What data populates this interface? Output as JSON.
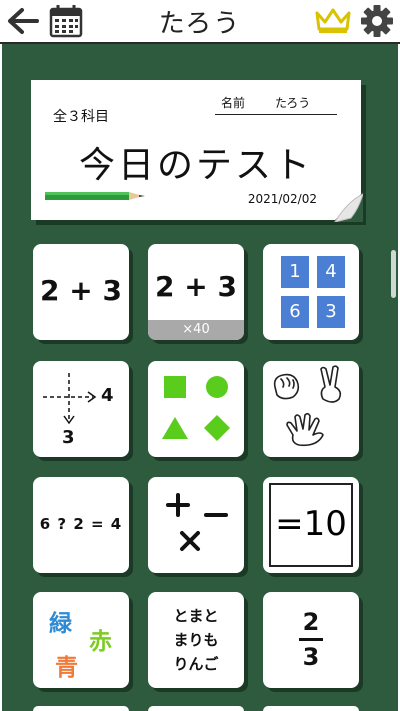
{
  "header": {
    "title": "たろう"
  },
  "test_note": {
    "subject_count": "全３科目",
    "name_label": "名前",
    "name_value": "たろう",
    "heading": "今日のテスト",
    "date": "2021/02/02"
  },
  "tiles": {
    "addition": {
      "label": "2 + 3"
    },
    "addition_timed": {
      "label": "2 + 3",
      "badge": "×40"
    },
    "number_cards": {
      "numbers": [
        "1",
        "4",
        "6",
        "3"
      ]
    },
    "number_line": {
      "right_value": "4",
      "down_value": "3"
    },
    "missing_operator": {
      "label": "6 ? 2 = 4"
    },
    "make_ten": {
      "label": "=10"
    },
    "color_words": {
      "word1": "緑",
      "word2": "赤",
      "word3": "青"
    },
    "word_chain": {
      "line1": "とまと",
      "line2": "まりも",
      "line3": "りんご"
    },
    "fraction": {
      "numerator": "2",
      "denominator": "3"
    }
  },
  "colors": {
    "board": "#2e5b3d",
    "number_card_blue": "#4a7fd4",
    "shape_green": "#59cc1c",
    "crown_yellow": "#d9c200",
    "word_blue": "#2d8bd6",
    "word_green": "#7ccc24",
    "word_orange": "#f07a3a"
  },
  "icons": [
    "back-arrow-icon",
    "calendar-icon",
    "crown-icon",
    "gear-icon",
    "pencil-icon",
    "shapes-icon",
    "rock-paper-scissors-icon",
    "plus-minus-times-icon"
  ]
}
